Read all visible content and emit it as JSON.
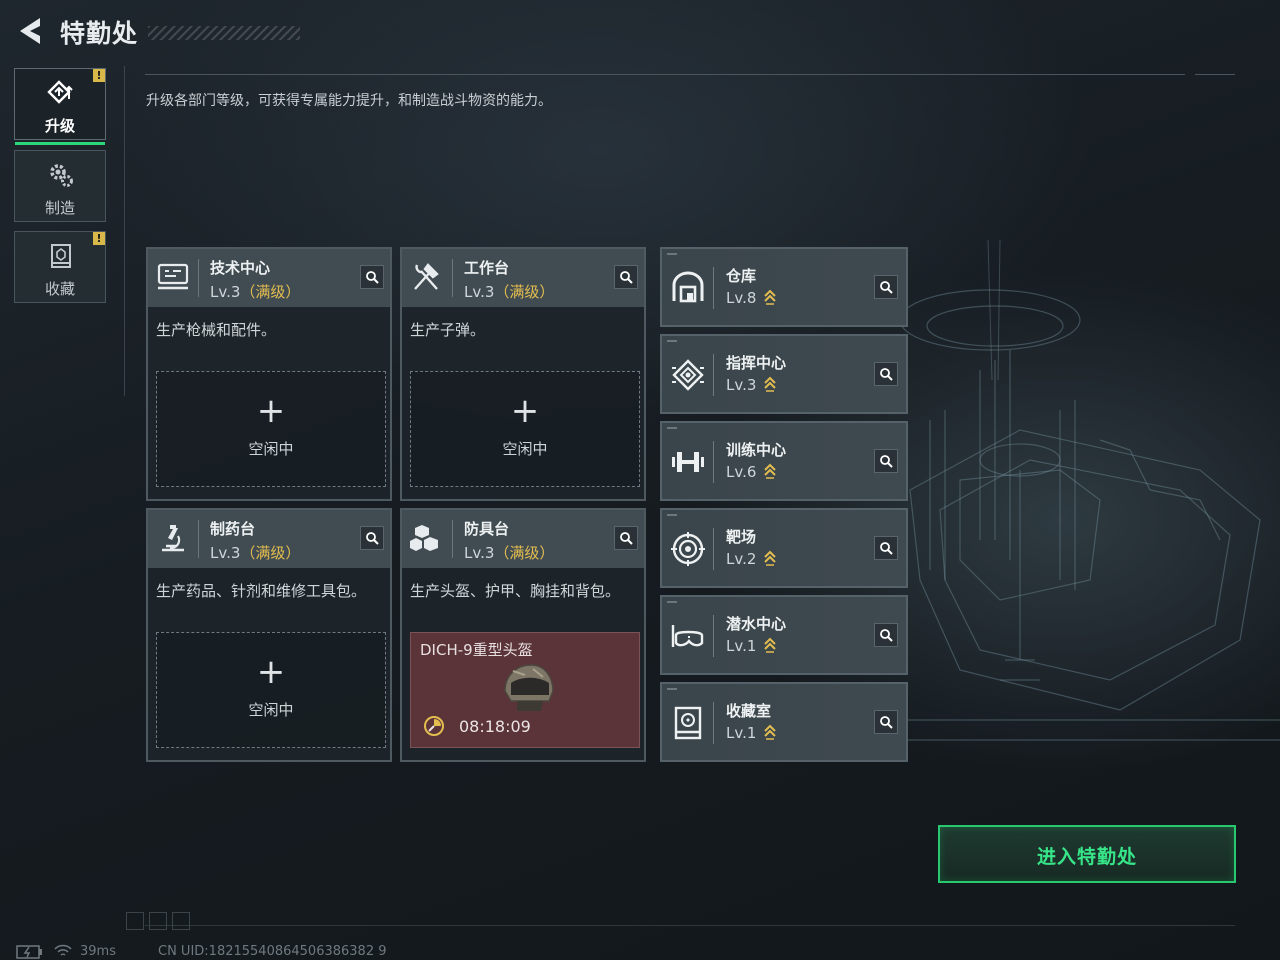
{
  "header": {
    "title": "特勤处",
    "description": "升级各部门等级，可获得专属能力提升，和制造战斗物资的能力。"
  },
  "side_tabs": [
    {
      "label": "升级",
      "icon": "upgrade-icon",
      "active": true,
      "badge": "!"
    },
    {
      "label": "制造",
      "icon": "gear-icon",
      "active": false,
      "badge": ""
    },
    {
      "label": "收藏",
      "icon": "collection-icon",
      "active": false,
      "badge": "!"
    }
  ],
  "production_cards": [
    {
      "name": "技术中心",
      "level": "Lv.3",
      "level_note": "（满级）",
      "description": "生产枪械和配件。",
      "slot": {
        "plus": "+",
        "status": "空闲中"
      },
      "icon": "tech-center-icon"
    },
    {
      "name": "工作台",
      "level": "Lv.3",
      "level_note": "（满级）",
      "description": "生产子弹。",
      "slot": {
        "plus": "+",
        "status": "空闲中"
      },
      "icon": "hammer-wrench-icon"
    },
    {
      "name": "制药台",
      "level": "Lv.3",
      "level_note": "（满级）",
      "description": "生产药品、针剂和维修工具包。",
      "slot": {
        "plus": "+",
        "status": "空闲中"
      },
      "icon": "microscope-icon"
    },
    {
      "name": "防具台",
      "level": "Lv.3",
      "level_note": "（满级）",
      "description": "生产头盔、护甲、胸挂和背包。",
      "slot": {
        "item": "DICH-9重型头盔",
        "timer": "08:18:09"
      },
      "icon": "armor-blocks-icon"
    }
  ],
  "facilities": [
    {
      "name": "仓库",
      "level": "Lv.8",
      "icon": "warehouse-icon"
    },
    {
      "name": "指挥中心",
      "level": "Lv.3",
      "icon": "command-chip-icon"
    },
    {
      "name": "训练中心",
      "level": "Lv.6",
      "icon": "dumbbell-icon"
    },
    {
      "name": "靶场",
      "level": "Lv.2",
      "icon": "target-icon"
    },
    {
      "name": "潜水中心",
      "level": "Lv.1",
      "icon": "diving-mask-icon"
    },
    {
      "name": "收藏室",
      "level": "Lv.1",
      "icon": "collection-room-icon"
    }
  ],
  "enter_button": {
    "label": "进入特勤处"
  },
  "status_bar": {
    "ping": "39ms",
    "uid": "CN UID:18215540864506386382 9"
  },
  "colors": {
    "accent_green": "#2ad87a",
    "maxed_gold": "#e3bd4f",
    "busy_slot": "#5a3438",
    "badge_yellow": "#d9b84a"
  }
}
